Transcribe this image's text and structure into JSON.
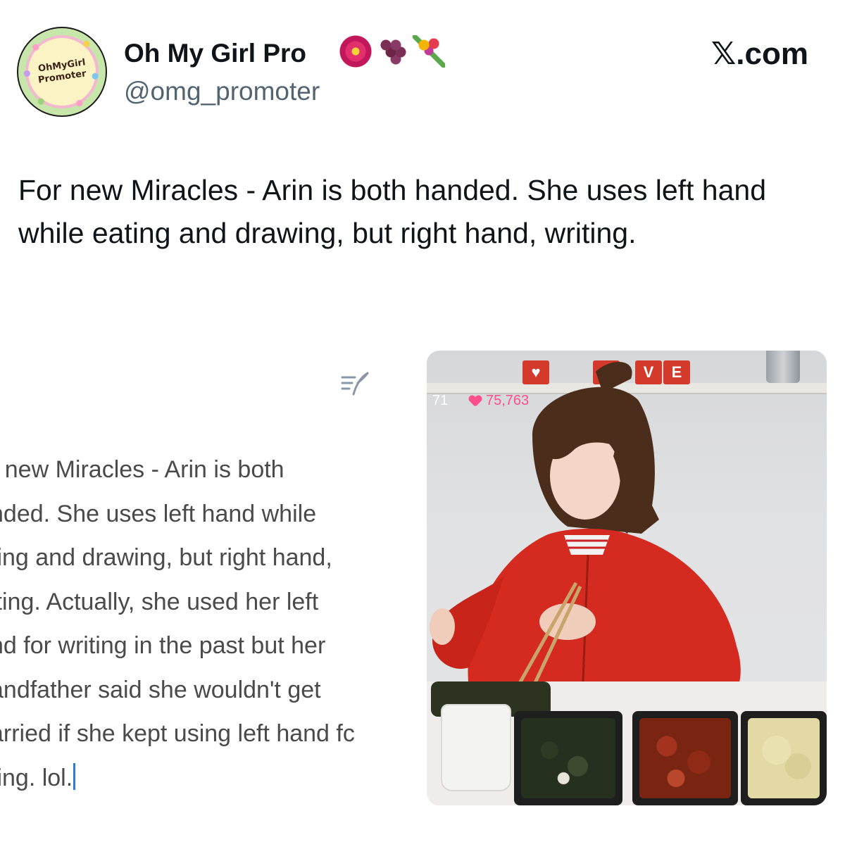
{
  "tweet": {
    "display_name": "Oh My Girl Pro",
    "name_emojis": [
      "hibiscus-emoji",
      "grapes-emoji",
      "bouquet-emoji"
    ],
    "handle": "@omg_promoter",
    "site": "𝕏.com",
    "avatar_text_line1": "OhMyGirl",
    "avatar_text_line2": "Promoter",
    "text": "For new Miracles - Arin is both handed. She uses left hand while eating and drawing, but right hand, writing."
  },
  "memo_screenshot": {
    "lines": [
      "r new Miracles - Arin is both",
      "nded. She uses left hand while",
      "ting and drawing, but right hand,",
      "iting. Actually, she used her left",
      "nd for writing in the past but her",
      "andfather said she wouldn't get",
      "arried if she kept using left hand fc",
      "ting. lol."
    ],
    "edit_icon": "compose-icon"
  },
  "live_photo": {
    "views": "71",
    "likes": "75,763",
    "shelf_letters": [
      "O",
      "V",
      "E"
    ],
    "colors": {
      "hoodie": "#d42a1f",
      "likes": "#ff4f8b"
    }
  }
}
